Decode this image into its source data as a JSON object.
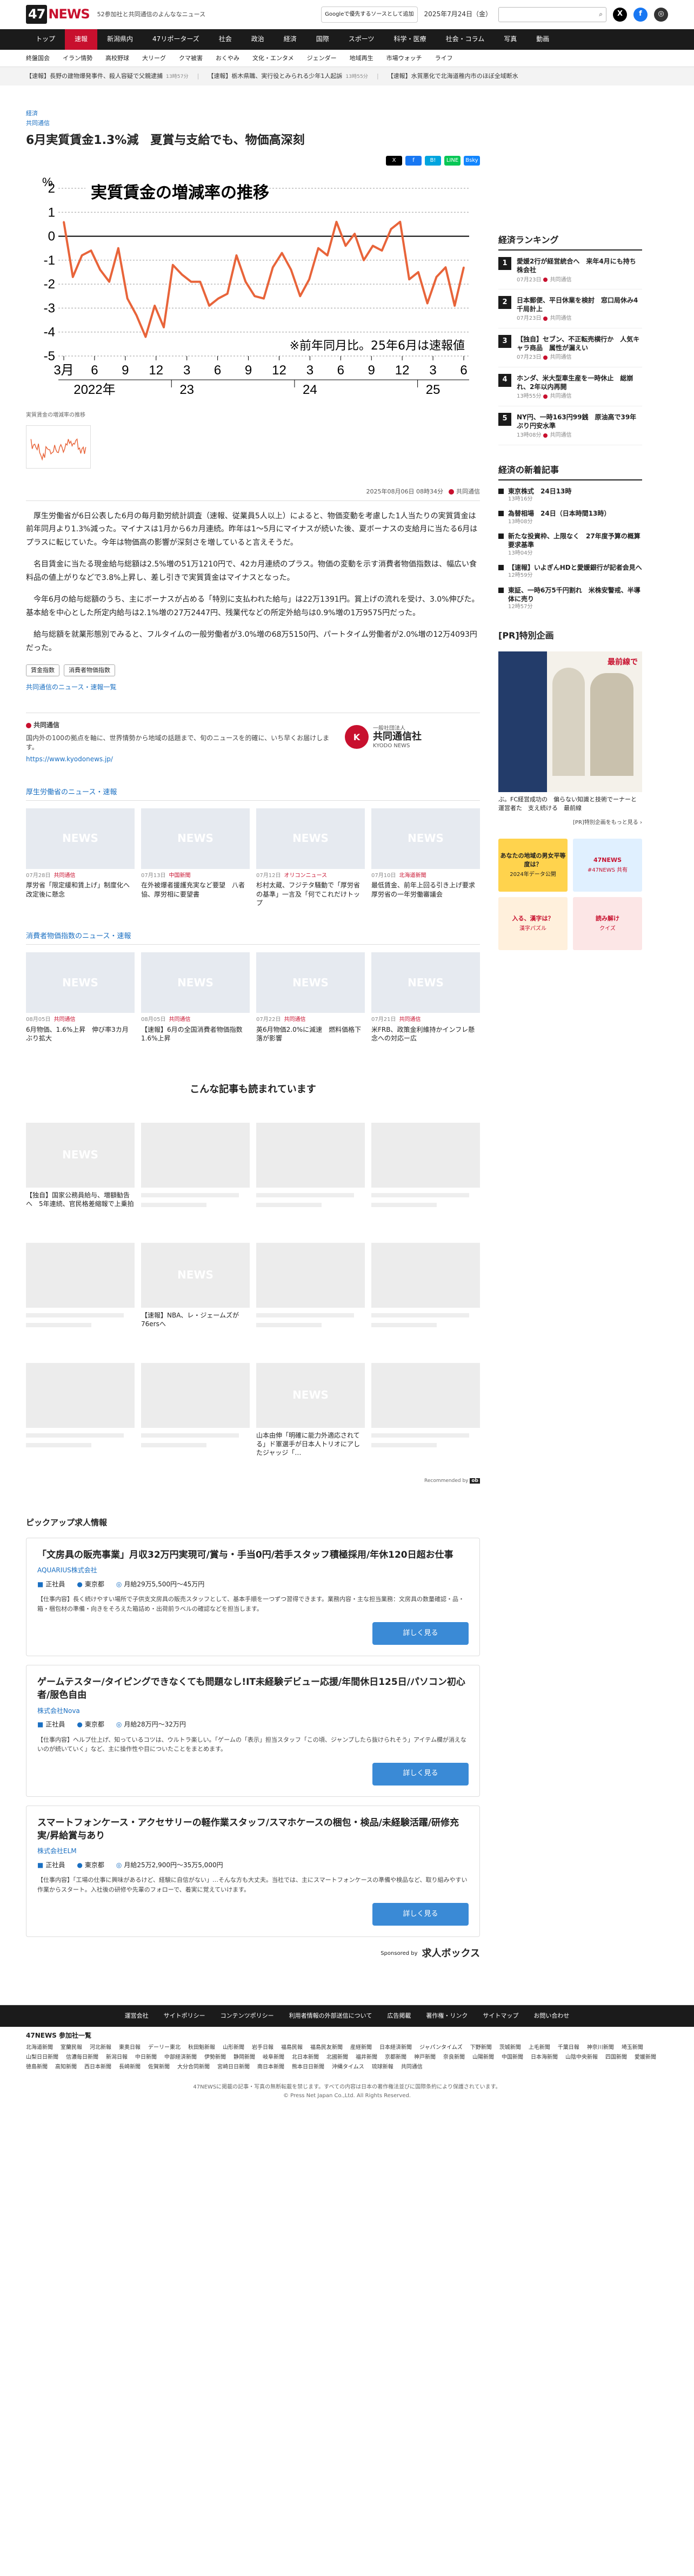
{
  "header": {
    "logo_47": "47",
    "logo_news": "NEWS",
    "tagline": "52参加社と共同通信のよんななニュース",
    "google_badge": "Googleで優先するソースとして追加",
    "date": "2025年7月24日（金）",
    "search_placeholder": "",
    "social": [
      {
        "name": "x-icon",
        "glyph": "X",
        "color": "#000000"
      },
      {
        "name": "facebook-icon",
        "glyph": "f",
        "color": "#1877f2"
      },
      {
        "name": "globe-icon",
        "glyph": "◎",
        "color": "#333333"
      }
    ]
  },
  "nav": [
    "トップ",
    "速報",
    "新潟県内",
    "47リポーターズ",
    "社会",
    "政治",
    "経済",
    "国際",
    "スポーツ",
    "科学・医療",
    "社会・コラム",
    "写真",
    "動画"
  ],
  "nav_active": 1,
  "subnav": [
    "終盤国会",
    "イラン情勢",
    "高校野球",
    "大リーグ",
    "クマ被害",
    "おくやみ",
    "文化・エンタメ",
    "ジェンダー",
    "地域再生",
    "市場ウォッチ",
    "ライフ"
  ],
  "ticker": [
    {
      "text": "【速報】長野の建物爆発事件、殺人容疑で父親逮捕",
      "time": "13時57分"
    },
    {
      "text": "【速報】栃木県職、実行役とみられる少年1人起訴",
      "time": "13時55分"
    },
    {
      "text": "【速報】水質悪化で北海道稚内市のほぼ全域断水"
    }
  ],
  "article": {
    "category": "経済",
    "source": "共同通信",
    "title": "6月実質賃金1.3%減　夏賞与支給でも、物価高深刻",
    "share": [
      {
        "label": "X",
        "color": "#000000"
      },
      {
        "label": "f",
        "color": "#1877f2"
      },
      {
        "label": "B!",
        "color": "#00a4de"
      },
      {
        "label": "LINE",
        "color": "#06c755"
      },
      {
        "label": "Bsky",
        "color": "#1185fe"
      }
    ],
    "caption": "実質賃金の増減率の推移",
    "date": "2025年08月06日 08時34分",
    "paragraphs": [
      "厚生労働省が6日公表した6月の毎月勤労統計調査（速報、従業員5人以上）によると、物価変動を考慮した1人当たりの実質賃金は前年同月より1.3%減った。マイナスは1月から6カ月連続。昨年は1〜5月にマイナスが続いた後、夏ボーナスの支給月に当たる6月はプラスに転じていた。今年は物価高の影響が深刻さを増していると言えそうだ。",
      "名目賃金に当たる現金給与総額は2.5%増の51万1210円で、42カ月連続のプラス。物価の変動を示す消費者物価指数は、幅広い食料品の値上がりなどで3.8%上昇し、差し引きで実質賃金はマイナスとなった。",
      "今年6月の給与総額のうち、主にボーナスが占める「特別に支払われた給与」は22万1391円。賞上げの流れを受け、3.0%伸びた。基本給を中心とした所定内給与は2.1%増の27万2447円、残業代などの所定外給与は0.9%増の1万9575円だった。",
      "給与総額を就業形態別でみると、フルタイムの一般労働者が3.0%増の68万5150円、パートタイム労働者が2.0%増の12万4093円だった。"
    ],
    "tags": [
      "賃金指数",
      "消費者物価指数"
    ],
    "related_link": "共同通信のニュース・速報一覧"
  },
  "chart_data": {
    "type": "line",
    "title": "実質賃金の増減率の推移",
    "ylabel": "%",
    "note": "※前年同月比。25年6月は速報値",
    "ylim": [
      -5,
      2
    ],
    "yticks": [
      2,
      1,
      0,
      -1,
      -2,
      -3,
      -4,
      -5
    ],
    "xticks": [
      "3月",
      "6",
      "9",
      "12",
      "3",
      "6",
      "9",
      "12",
      "3",
      "6",
      "9",
      "12",
      "3",
      "6"
    ],
    "year_labels": [
      "2022年",
      "23",
      "24",
      "25"
    ],
    "series": [
      {
        "values": [
          0.6,
          -1.7,
          -0.8,
          -0.6,
          -1.4,
          -1.9,
          -0.5,
          -2.6,
          -3.3,
          -4.2,
          -2.9,
          -3.8,
          -1.2,
          -1.6,
          -1.9,
          -1.9,
          -2.9,
          -2.6,
          -2.4,
          -0.8,
          -1.9,
          -2.5,
          -2.6,
          -1.3,
          -0.7,
          -1.4,
          -2.5,
          -1.8,
          -0.5,
          -0.8,
          0.6,
          -0.4,
          0.1,
          -1.0,
          -0.4,
          -0.6,
          0.3,
          0.6,
          -1.8,
          -1.5,
          -2.8,
          -1.7,
          -1.3,
          -2.9,
          -1.3
        ]
      }
    ],
    "colors": {
      "line": "#e8643a",
      "zero": "#000000",
      "grid": "#999999"
    }
  },
  "provider": {
    "name": "共同通信",
    "text": "国内外の100の拠点を軸に、世界情勢から地域の話題まで、旬のニュースを的確に、いち早くお届けします。",
    "url": "https://www.kyodonews.jp/",
    "logo_main": "共同通信社",
    "logo_sub": "KYODO NEWS",
    "logo_top": "一般社団法人"
  },
  "sections": [
    {
      "title": "厚生労働省のニュース・速報",
      "cards": [
        {
          "date": "07月28日",
          "src": "共同通信",
          "head": "厚労省「限定緩和賃上げ」制度化へ　改定後に懸念"
        },
        {
          "date": "07月13日",
          "src": "中国新聞",
          "head": "在外被爆者援護充実など要望　八者協、厚労相に要望書"
        },
        {
          "date": "07月12日",
          "src": "オリコンニュース",
          "head": "杉村太蔵、フジテタ騒動で「厚労省の基準」一言及「何でこれだけトップ"
        },
        {
          "date": "07月10日",
          "src": "北海道新聞",
          "head": "最低賃金、前年上回る引き上げ要求　厚労省の一年労働審議会"
        }
      ]
    },
    {
      "title": "消費者物価指数のニュース・速報",
      "cards": [
        {
          "date": "08月05日",
          "src": "共同通信",
          "head": "6月物価、1.6%上昇　伸び率3カ月ぶり拡大"
        },
        {
          "date": "08月05日",
          "src": "共同通信",
          "head": "【速報】6月の全国消費者物価指数1.6%上昇"
        },
        {
          "date": "07月22日",
          "src": "共同通信",
          "head": "英6月物価2.0%に減速　燃料価格下落が影響"
        },
        {
          "date": "07月21日",
          "src": "共同通信",
          "head": "米FRB、政策金利維持かインフレ懸念への対応ー広"
        }
      ]
    }
  ],
  "also_read": {
    "title": "こんな記事も読まれています",
    "items": [
      {
        "head": "【独自】国家公務員給与、増額勧告へ　5年連続、官民格差縮報で上乗拍"
      },
      {
        "head": ""
      },
      {
        "head": ""
      },
      {
        "head": ""
      },
      {
        "head": ""
      },
      {
        "head": "【速報】NBA、レ・ジェームズが76ersへ"
      },
      {
        "head": ""
      },
      {
        "head": ""
      },
      {
        "head": ""
      },
      {
        "head": ""
      },
      {
        "head": "山本由伸「明確に能力外適応されてる」ド軍選手が日本人トリオにアしたジャッジ「…"
      },
      {
        "head": ""
      }
    ],
    "recommended_by": "Recommended by"
  },
  "jobs": {
    "title": "ピックアップ求人情報",
    "items": [
      {
        "title": "「文房具の販売事業」月収32万円実現可/賞与・手当0円/若手スタッフ積極採用/年休120日超お仕事",
        "company": "AQUARIUS株式会社",
        "type": "正社員",
        "loc": "東京都",
        "pay": "月給29万5,500円〜45万円",
        "desc": "【仕事内容】長く続けやすい場所で子供支文房具の販売スタッフとして、基本手順を一つずつ習得できます。業務内容・主な担当業務：文房具の数量確認・品・箱・梱包材の準備・向きをそろえた箱詰め・出荷前ラベルの確認などを担当します。",
        "btn": "詳しく見る"
      },
      {
        "title": "ゲームテスター/タイピングできなくても問題なし!IT未経験デビュー応援/年間休日125日/パソコン初心者/服色自由",
        "company": "株式会社Nova",
        "type": "正社員",
        "loc": "東京都",
        "pay": "月給28万円〜32万円",
        "desc": "【仕事内容】ヘルプ仕上げ、知っているコツは、ウルトラ楽しい。「ゲームの「表示」担当スタッフ「この頃、ジャンプしたら抜けられそう」アイテム欄が消えないのが続いていく」など、主に操作性や目についたことをまとめます。",
        "btn": "詳しく見る"
      },
      {
        "title": "スマートフォンケース・アクセサリーの軽作業スタッフ/スマホケースの梱包・検品/未経験活躍/研修充実/昇給賞与あり",
        "company": "株式会社ELM",
        "type": "正社員",
        "loc": "東京都",
        "pay": "月給25万2,900円〜35万5,000円",
        "desc": "【仕事内容】「工場の仕事に興味があるけど、経験に自信がない」…そんな方も大丈夫。当社では、主にスマートフォンケースの準備や検品など、取り組みやすい作業からスタート。入社後の研修や先輩のフォローで、着実に覚えていけます。",
        "btn": "詳しく見る"
      }
    ],
    "sponsored": "Sponsored by",
    "sponsor": "求人ボックス"
  },
  "sidebar": {
    "ranking_title": "経済ランキング",
    "ranking": [
      {
        "text": "愛媛2行が経営統合へ　来年4月にも持ち株会社",
        "date": "07月23日",
        "src": "共同通信"
      },
      {
        "text": "日本郵便、平日休業を検討　窓口局休み4千局計上",
        "date": "07月23日",
        "src": "共同通信"
      },
      {
        "text": "【独自】セブン、不正転売横行か　人気キャラ商品　属性が漏えい",
        "date": "07月23日",
        "src": "共同通信"
      },
      {
        "text": "ホンダ、米大型車生産を一時休止　総崩れ、2年以内再開",
        "date": "13時55分",
        "src": "共同通信"
      },
      {
        "text": "NY円、一時163円99銭　原油高で39年ぶり円安水準",
        "date": "13時08分",
        "src": "共同通信"
      }
    ],
    "latest_title": "経済の新着記事",
    "latest": [
      {
        "text": "東京株式　24日13時",
        "time": "13時16分"
      },
      {
        "text": "為替相場　24日（日本時間13時）",
        "time": "13時08分"
      },
      {
        "text": "新たな投資枠、上限なく　27年度予算の概算要求基準",
        "time": "13時04分"
      },
      {
        "text": "【速報】いよぎんHDと愛媛銀行が記者会見へ",
        "time": "12時59分"
      },
      {
        "text": "東証、一時6万5千円割れ　米株安警戒、半導体に売り",
        "time": "12時57分"
      }
    ],
    "pr_title": "[PR]特別企画",
    "pr_caption": "ぶ。FC経営成功の　偏らない知識と技術でーナーと運営者た　支え続ける　最前線",
    "pr_more": "[PR]特別企画をもっと見る ›",
    "pr_badge": "最前線で",
    "ads": [
      {
        "text": "あなたの地域の男女平等度は？",
        "sub": "2024年データ公開",
        "bg": "#ffd34d",
        "fg": "#222222"
      },
      {
        "text": "47NEWS",
        "sub": "#47NEWS 共有",
        "bg": "#e0f0ff",
        "fg": "#c8102e"
      },
      {
        "text": "入る、漢字は？",
        "sub": "漢字パズル",
        "bg": "#fff0dc",
        "fg": "#c8102e"
      },
      {
        "text": "読み解け",
        "sub": "クイズ",
        "bg": "#fce6e6",
        "fg": "#c8102e"
      }
    ]
  },
  "footer": {
    "nav": [
      "運営会社",
      "サイトポリシー",
      "コンテンツポリシー",
      "利用者情報の外部送信について",
      "広告掲載",
      "著作権・リンク",
      "サイトマップ",
      "お問い合わせ"
    ],
    "members_title": "47NEWS 参加社一覧",
    "members": [
      "北海道新聞",
      "室蘭民報",
      "河北新報",
      "東奥日報",
      "デーリー東北",
      "秋田魁新報",
      "山形新聞",
      "岩手日報",
      "福島民報",
      "福島民友新聞",
      "産経新聞",
      "日本経済新聞",
      "ジャパンタイムズ",
      "下野新聞",
      "茨城新聞",
      "上毛新聞",
      "千葉日報",
      "神奈川新聞",
      "埼玉新聞",
      "山梨日日新聞",
      "信濃毎日新聞",
      "新潟日報",
      "中日新聞",
      "中部経済新聞",
      "伊勢新聞",
      "静岡新聞",
      "岐阜新聞",
      "北日本新聞",
      "北國新聞",
      "福井新聞",
      "京都新聞",
      "神戸新聞",
      "奈良新聞",
      "山陽新聞",
      "中国新聞",
      "日本海新聞",
      "山陰中央新報",
      "四国新聞",
      "愛媛新聞",
      "徳島新聞",
      "高知新聞",
      "西日本新聞",
      "長崎新聞",
      "佐賀新聞",
      "大分合同新聞",
      "宮崎日日新聞",
      "南日本新聞",
      "熊本日日新聞",
      "沖縄タイムス",
      "琉球新報",
      "共同通信"
    ],
    "notice": "47NEWSに掲載の記事・写真の無断転載を禁じます。すべての内容は日本の著作権法並びに国際条約により保護されています。",
    "copyright": "© Press Net Japan Co.,Ltd. All Rights Reserved."
  }
}
